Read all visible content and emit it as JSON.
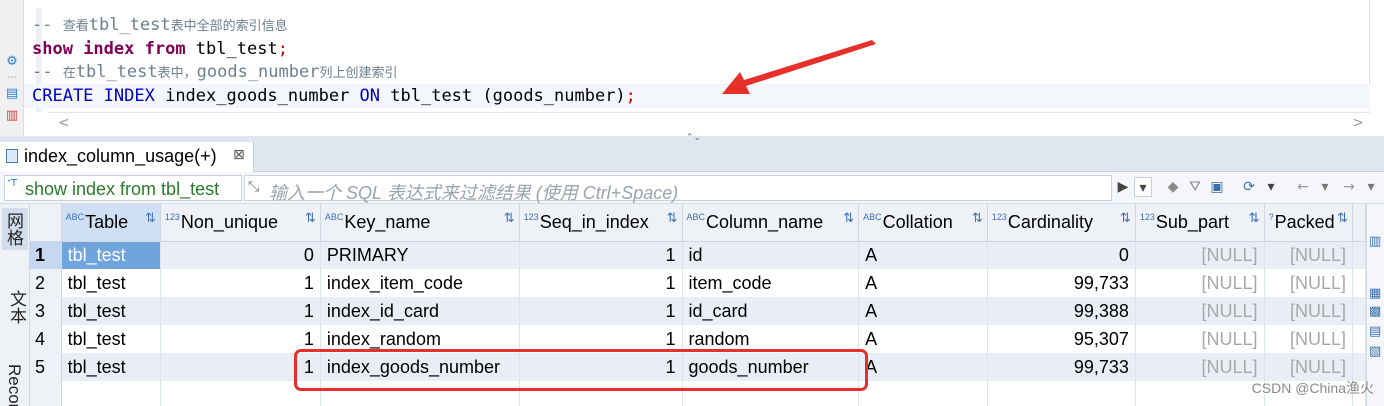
{
  "editor": {
    "lines": [
      {
        "type": "comment",
        "prefix": "-- ",
        "part1": "查看",
        "mono1": "tbl_test",
        "part2": "表中全部的索引信息"
      },
      {
        "type": "code",
        "tokens": [
          [
            "kw",
            "show "
          ],
          [
            "kw",
            "index "
          ],
          [
            "kw",
            "from "
          ],
          [
            "plain",
            "tbl_test"
          ],
          [
            "semi",
            ";"
          ]
        ]
      },
      {
        "type": "comment",
        "prefix": "-- ",
        "part1": "在",
        "mono1": "tbl_test",
        "part2": "表中，",
        "mono2": "goods_number",
        "part3": "列上创建索引"
      },
      {
        "type": "code",
        "tokens": [
          [
            "kw2",
            "CREATE "
          ],
          [
            "kw2",
            "INDEX "
          ],
          [
            "plain",
            "index_goods_number "
          ],
          [
            "kw2",
            "ON "
          ],
          [
            "plain",
            "tbl_test (goods_number)"
          ],
          [
            "semi",
            ";"
          ]
        ]
      }
    ],
    "scroll_left": "<",
    "scroll_right": ">",
    "splitter_grip": "⌃⌄"
  },
  "result_tab": {
    "label": "index_column_usage(+)",
    "close_icon": "⊠"
  },
  "filter_bar": {
    "query_text": "show index from tbl_test",
    "query_icon": "ᐩT",
    "filter_placeholder": "输入一个 SQL 表达式来过滤结果 (使用 Ctrl+Space)"
  },
  "side_tabs": [
    "网格",
    "文本",
    "Record"
  ],
  "grid": {
    "columns": [
      {
        "type_icon": "ABC",
        "label": "Table"
      },
      {
        "type_icon": "123",
        "label": "Non_unique"
      },
      {
        "type_icon": "ABC",
        "label": "Key_name"
      },
      {
        "type_icon": "123",
        "label": "Seq_in_index"
      },
      {
        "type_icon": "ABC",
        "label": "Column_name"
      },
      {
        "type_icon": "ABC",
        "label": "Collation"
      },
      {
        "type_icon": "123",
        "label": "Cardinality"
      },
      {
        "type_icon": "123",
        "label": "Sub_part"
      },
      {
        "type_icon": "?",
        "label": "Packed"
      }
    ],
    "rows": [
      {
        "n": "1",
        "cells": [
          "tbl_test",
          "0",
          "PRIMARY",
          "1",
          "id",
          "A",
          "0",
          "[NULL]",
          "[NULL]"
        ]
      },
      {
        "n": "2",
        "cells": [
          "tbl_test",
          "1",
          "index_item_code",
          "1",
          "item_code",
          "A",
          "99,733",
          "[NULL]",
          "[NULL]"
        ]
      },
      {
        "n": "3",
        "cells": [
          "tbl_test",
          "1",
          "index_id_card",
          "1",
          "id_card",
          "A",
          "99,388",
          "[NULL]",
          "[NULL]"
        ]
      },
      {
        "n": "4",
        "cells": [
          "tbl_test",
          "1",
          "index_random",
          "1",
          "random",
          "A",
          "95,307",
          "[NULL]",
          "[NULL]"
        ]
      },
      {
        "n": "5",
        "cells": [
          "tbl_test",
          "1",
          "index_goods_number",
          "1",
          "goods_number",
          "A",
          "99,733",
          "[NULL]",
          "[NULL]"
        ]
      }
    ],
    "selected_row": 0
  },
  "annotation": {
    "arrow_color": "#e8302a",
    "highlight_color": "#e8302a"
  },
  "watermark": "CSDN @China渔火"
}
